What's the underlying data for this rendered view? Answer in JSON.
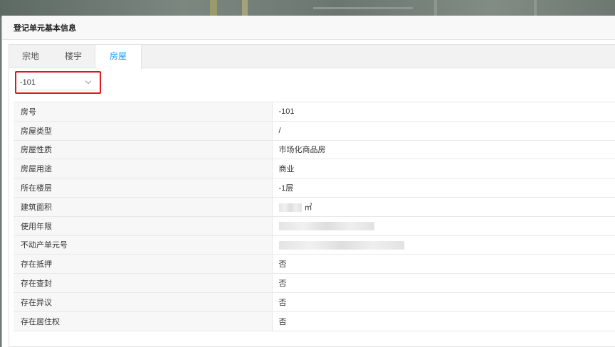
{
  "dialog": {
    "title": "登记单元基本信息"
  },
  "tabs": [
    {
      "label": "宗地",
      "active": false
    },
    {
      "label": "楼宇",
      "active": false
    },
    {
      "label": "房屋",
      "active": true
    }
  ],
  "house_selector": {
    "selected": "-101",
    "highlight_color": "#e0171a"
  },
  "info_rows": [
    {
      "label": "房号",
      "value": "-101"
    },
    {
      "label": "房屋类型",
      "value": "/"
    },
    {
      "label": "房屋性质",
      "value": "市场化商品房"
    },
    {
      "label": "房屋用途",
      "value": "商业"
    },
    {
      "label": "所在楼层",
      "value": "-1层"
    },
    {
      "label": "建筑面积",
      "value": "",
      "redacted": true,
      "unit": "㎡"
    },
    {
      "label": "使用年限",
      "value": "",
      "redacted": true
    },
    {
      "label": "不动产单元号",
      "value": "",
      "redacted": true
    },
    {
      "label": "存在抵押",
      "value": "否"
    },
    {
      "label": "存在查封",
      "value": "否"
    },
    {
      "label": "存在异议",
      "value": "否"
    },
    {
      "label": "存在居住权",
      "value": "否"
    }
  ],
  "colors": {
    "active_tab": "#1e9fff",
    "label_bg": "#f7f7f7"
  }
}
